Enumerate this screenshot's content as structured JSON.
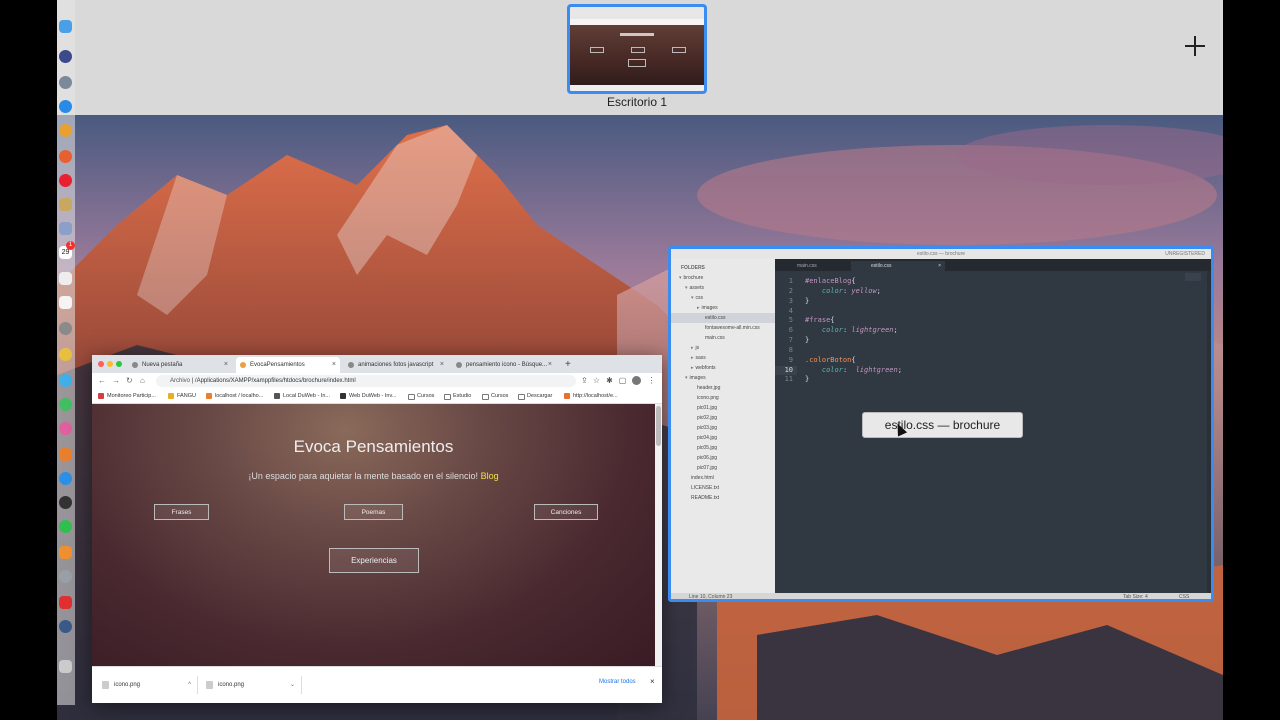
{
  "spaces": {
    "desktop_label": "Escritorio 1",
    "add_icon": "plus-icon"
  },
  "dock": {
    "badge": "1",
    "date_icon_text": "29"
  },
  "browser": {
    "tabs": [
      {
        "label": "Nueva pestaña"
      },
      {
        "label": "EvocaPensamientos"
      },
      {
        "label": "animaciones fotos javascript"
      },
      {
        "label": "pensamiento icono - Búsque..."
      }
    ],
    "omnibox": {
      "scheme": "Archivo",
      "path": "/Applications/XAMPP/xamppfiles/htdocs/brochure/index.html"
    },
    "bookmarks": [
      {
        "label": "Monitoreo Particip...",
        "icon": "bookmark-icon"
      },
      {
        "label": "FANGU",
        "icon": "bookmark-icon"
      },
      {
        "label": "localhost / localho...",
        "icon": "bookmark-icon"
      },
      {
        "label": "Local DuWeb - In...",
        "icon": "bookmark-icon"
      },
      {
        "label": "Web DuWeb - Inv...",
        "icon": "bookmark-icon"
      },
      {
        "label": "Cursos",
        "icon": "folder-icon"
      },
      {
        "label": "Estudio",
        "icon": "folder-icon"
      },
      {
        "label": "Cursos",
        "icon": "folder-icon"
      },
      {
        "label": "Descargar",
        "icon": "folder-icon"
      },
      {
        "label": "http://localhost/e...",
        "icon": "bookmark-icon"
      }
    ],
    "page": {
      "title": "Evoca Pensamientos",
      "subtitle": "¡Un espacio para aquietar la mente basado en el silencio!",
      "subtitle_link": "Blog",
      "buttons": [
        "Frases",
        "Poemas",
        "Canciones"
      ],
      "big_button": "Experiencias"
    },
    "downloads": {
      "items": [
        {
          "label": "icono.png"
        },
        {
          "label": "icono.png"
        }
      ],
      "show_all": "Mostrar todos"
    }
  },
  "editor": {
    "title": "estilo.css — brochure",
    "unregistered": "UNREGISTERED",
    "sidebar_header": "FOLDERS",
    "tree": [
      {
        "label": "brochure",
        "type": "folder"
      },
      {
        "label": "assets",
        "type": "folder"
      },
      {
        "label": "css",
        "type": "folder"
      },
      {
        "label": "images",
        "type": "folder"
      },
      {
        "label": "estilo.css",
        "type": "file",
        "selected": true
      },
      {
        "label": "fontawesome-all.min.css",
        "type": "file"
      },
      {
        "label": "main.css",
        "type": "file"
      },
      {
        "label": "js",
        "type": "folder"
      },
      {
        "label": "sass",
        "type": "folder"
      },
      {
        "label": "webfonts",
        "type": "folder"
      },
      {
        "label": "images",
        "type": "folder"
      },
      {
        "label": "header.jpg",
        "type": "file"
      },
      {
        "label": "icono.png",
        "type": "file"
      },
      {
        "label": "pic01.jpg",
        "type": "file"
      },
      {
        "label": "pic02.jpg",
        "type": "file"
      },
      {
        "label": "pic03.jpg",
        "type": "file"
      },
      {
        "label": "pic04.jpg",
        "type": "file"
      },
      {
        "label": "pic05.jpg",
        "type": "file"
      },
      {
        "label": "pic06.jpg",
        "type": "file"
      },
      {
        "label": "pic07.jpg",
        "type": "file"
      },
      {
        "label": "index.html",
        "type": "file"
      },
      {
        "label": "LICENSE.txt",
        "type": "file"
      },
      {
        "label": "README.txt",
        "type": "file"
      }
    ],
    "tabs": [
      {
        "label": "main.css"
      },
      {
        "label": "estilo.css"
      }
    ],
    "line_numbers": [
      "1",
      "2",
      "3",
      "4",
      "5",
      "6",
      "7",
      "8",
      "9",
      "10",
      "11"
    ],
    "status_left": "Line 10, Column 23",
    "status_tab": "Tab Size: 4",
    "status_syntax": "CSS",
    "tooltip": "estilo.css — brochure"
  }
}
